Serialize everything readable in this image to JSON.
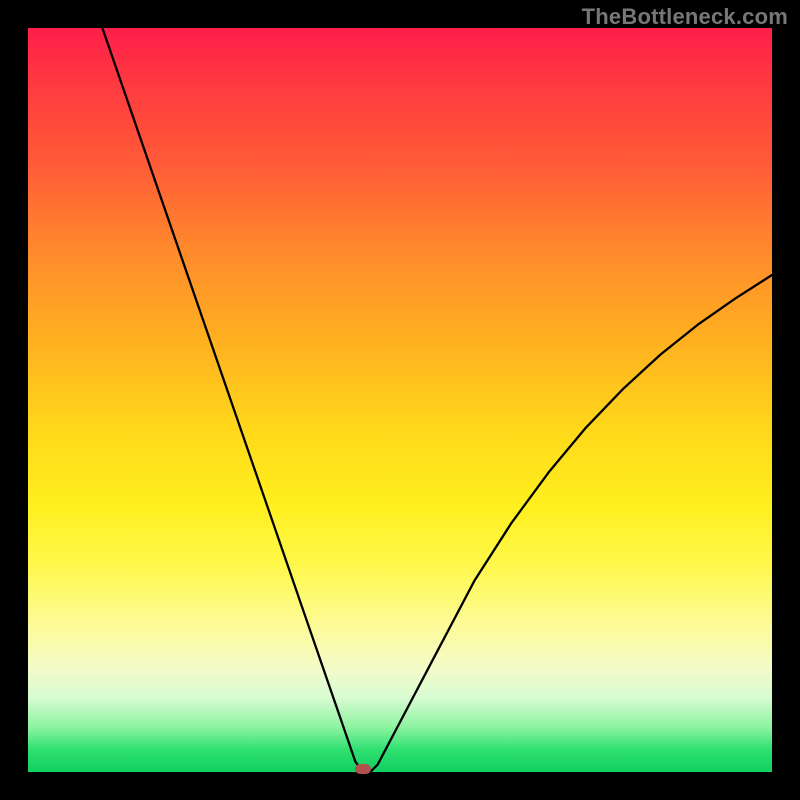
{
  "watermark": "TheBottleneck.com",
  "colors": {
    "curve": "#000000",
    "marker": "#b0514e",
    "gradient_top": "#ff1e4a",
    "gradient_mid": "#ffe81a",
    "gradient_bottom": "#10d060",
    "frame": "#000000"
  },
  "chart_data": {
    "type": "line",
    "title": "",
    "xlabel": "",
    "ylabel": "",
    "xlim": [
      0,
      100
    ],
    "ylim": [
      0,
      100
    ],
    "annotations": [
      "TheBottleneck.com"
    ],
    "description": "V-shaped bottleneck curve over a vertical rainbow gradient (red=high mismatch at top, green=balanced at bottom). Minimum at approximately x≈45 where y≈0.",
    "min_point": {
      "x": 45,
      "y": 0
    },
    "series": [
      {
        "name": "bottleneck-curve",
        "x": [
          10,
          15,
          20,
          25,
          30,
          35,
          38,
          40,
          42,
          43,
          44,
          45,
          46,
          47,
          50,
          55,
          60,
          65,
          70,
          75,
          80,
          85,
          90,
          95,
          100
        ],
        "y": [
          100,
          85.5,
          71,
          56.5,
          42,
          27.5,
          18.8,
          13,
          7.2,
          4.3,
          1.4,
          0,
          0,
          1,
          6.7,
          16.2,
          25.7,
          33.5,
          40.3,
          46.3,
          51.5,
          56.1,
          60.1,
          63.6,
          66.8
        ]
      }
    ]
  }
}
